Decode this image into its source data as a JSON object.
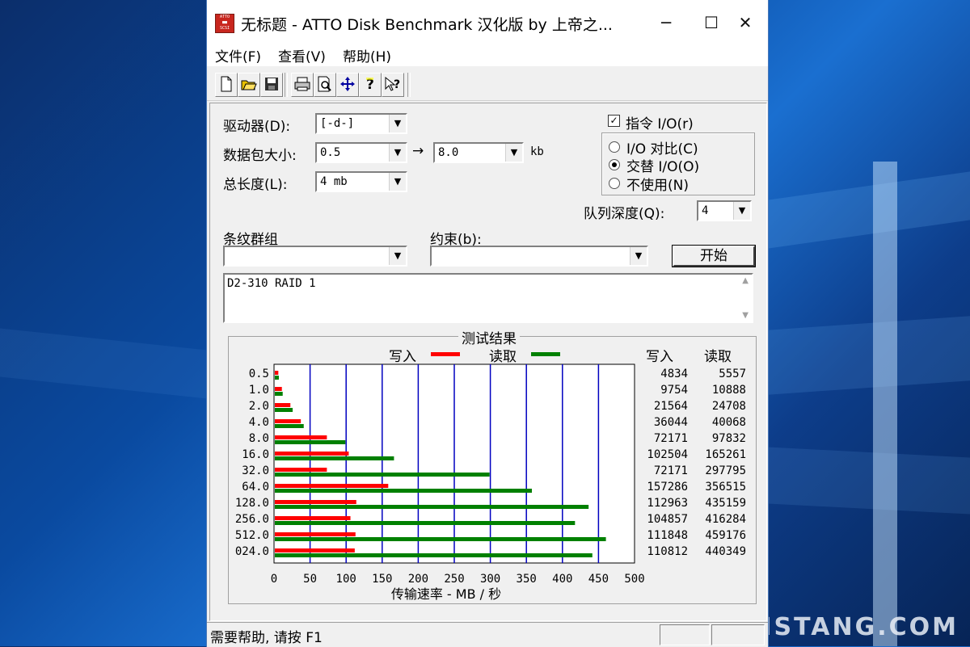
{
  "window": {
    "title": "无标题 - ATTO Disk Benchmark  汉化版 by 上帝之...",
    "icon_text": "ATTO",
    "minimize": "─",
    "maximize": "☐",
    "close": "✕"
  },
  "menu": [
    "文件(F)",
    "查看(V)",
    "帮助(H)"
  ],
  "toolbar": [
    "new-icon",
    "open-icon",
    "save-icon",
    "print-icon",
    "print-preview-icon",
    "move-icon",
    "help-icon",
    "context-help-icon"
  ],
  "settings": {
    "drive_label": "驱动器(D):",
    "drive_value": "[-d-]",
    "transfer_label": "数据包大小:",
    "transfer_from": "0.5",
    "transfer_arrow": "→",
    "transfer_to": "8.0",
    "transfer_unit": "kb",
    "length_label": "总长度(L):",
    "length_value": "4 mb",
    "io_label": "指令 I/O(r)",
    "io_checked": true,
    "radio_compare": "I/O 对比(C)",
    "radio_overlap": "交替 I/O(O)",
    "radio_none": "不使用(N)",
    "queue_label": "队列深度(Q):",
    "queue_value": "4",
    "stripe_label": "条纹群组",
    "stripe_value": "",
    "constraint_label": "约束(b):",
    "constraint_value": "",
    "start_button": "开始",
    "description": "D2-310 RAID 1"
  },
  "results": {
    "title": "测试结果",
    "legend_write": "写入",
    "legend_read": "读取",
    "col_write": "写入",
    "col_read": "读取",
    "xlabel": "传输速率 - MB / 秒"
  },
  "chart_data": {
    "type": "bar",
    "title": "测试结果",
    "xlabel": "传输速率 - MB / 秒",
    "categories": [
      "0.5",
      "1.0",
      "2.0",
      "4.0",
      "8.0",
      "16.0",
      "32.0",
      "64.0",
      "128.0",
      "256.0",
      "512.0",
      "024.0"
    ],
    "series": [
      {
        "name": "写入",
        "color": "#ff0000",
        "values": [
          4834,
          9754,
          21564,
          36044,
          72171,
          102504,
          72171,
          157286,
          112963,
          104857,
          111848,
          110812
        ]
      },
      {
        "name": "读取",
        "color": "#008000",
        "values": [
          5557,
          10888,
          24708,
          40068,
          97832,
          165261,
          297795,
          356515,
          435159,
          416284,
          459176,
          440349
        ]
      }
    ],
    "xticks": [
      "0",
      "50",
      "100",
      "150",
      "200",
      "250",
      "300",
      "350",
      "400",
      "450",
      "500"
    ],
    "xlim": [
      0,
      500
    ],
    "value_unit_divisor": 1000,
    "grid": true,
    "grid_color": "#0000c0"
  },
  "status": {
    "text": "需要帮助, 请按 F1"
  },
  "watermark": "WEISTANG.COM"
}
